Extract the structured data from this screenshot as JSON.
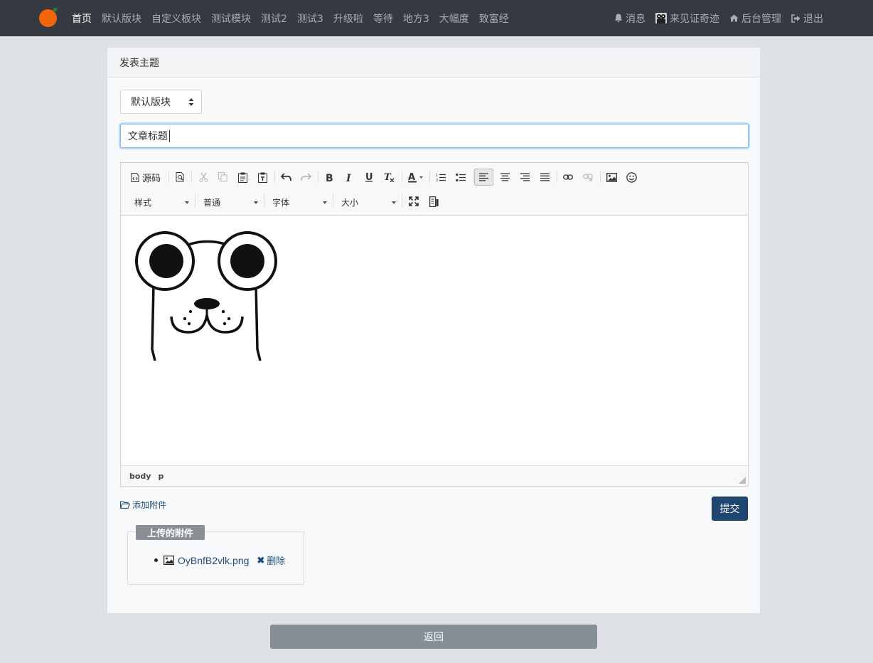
{
  "navbar": {
    "left_items": [
      {
        "label": "首页",
        "active": true
      },
      {
        "label": "默认版块"
      },
      {
        "label": "自定义板块"
      },
      {
        "label": "测试模块"
      },
      {
        "label": "测试2"
      },
      {
        "label": "测试3"
      },
      {
        "label": "升级啦"
      },
      {
        "label": "等待"
      },
      {
        "label": "地方3"
      },
      {
        "label": "大幅度"
      },
      {
        "label": "致富经"
      }
    ],
    "right_items": [
      {
        "label": "消息",
        "icon": "bell-icon"
      },
      {
        "label": "来见证奇迹",
        "icon": "avatar-icon"
      },
      {
        "label": "后台管理",
        "icon": "home-icon"
      },
      {
        "label": "退出",
        "icon": "sign-out-icon"
      }
    ]
  },
  "card": {
    "header": "发表主题",
    "forum_select": "默认版块",
    "title_value": "文章标题"
  },
  "editor": {
    "source_label": "源码",
    "combos": {
      "style": "样式",
      "format": "普通",
      "font": "字体",
      "size": "大小"
    },
    "path": [
      "body",
      "p"
    ]
  },
  "attachments": {
    "add_label": "添加附件",
    "legend": "上传的附件",
    "items": [
      {
        "filename": "OyBnfB2vlk.png",
        "delete_label": "删除"
      }
    ]
  },
  "buttons": {
    "submit": "提交",
    "back": "返回"
  },
  "colors": {
    "navbar_bg": "#343a40",
    "submit_bg": "#1f4670",
    "back_bg": "#868e96",
    "link": "#1f4e79"
  }
}
